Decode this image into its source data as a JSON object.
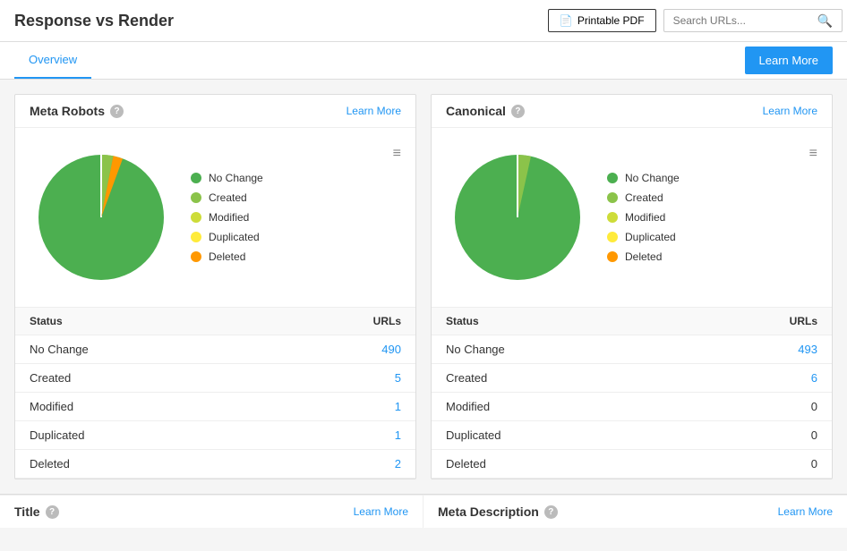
{
  "header": {
    "title": "Response vs Render",
    "printable_btn": "Printable PDF",
    "search_placeholder": "Search URLs...",
    "learn_more_btn": "Learn More"
  },
  "nav": {
    "tabs": [
      {
        "label": "Overview",
        "active": true
      }
    ],
    "learn_more": "Learn More"
  },
  "cards": [
    {
      "id": "meta-robots",
      "title": "Meta Robots",
      "learn_more": "Learn More",
      "legend": [
        {
          "label": "No Change",
          "color": "#4caf50"
        },
        {
          "label": "Created",
          "color": "#8bc34a"
        },
        {
          "label": "Modified",
          "color": "#cddc39"
        },
        {
          "label": "Duplicated",
          "color": "#ffeb3b"
        },
        {
          "label": "Deleted",
          "color": "#ff9800"
        }
      ],
      "pie": {
        "segments": [
          {
            "label": "No Change",
            "value": 490,
            "color": "#4caf50",
            "percentage": 97.4
          },
          {
            "label": "Created",
            "value": 5,
            "color": "#8bc34a",
            "percentage": 1.0
          },
          {
            "label": "Modified",
            "value": 1,
            "color": "#cddc39",
            "percentage": 0.2
          },
          {
            "label": "Duplicated",
            "value": 1,
            "color": "#ffeb3b",
            "percentage": 0.2
          },
          {
            "label": "Deleted",
            "value": 2,
            "color": "#ff9800",
            "percentage": 0.4
          }
        ]
      },
      "table": {
        "headers": [
          "Status",
          "URLs"
        ],
        "rows": [
          {
            "status": "No Change",
            "urls": "490",
            "is_link": true
          },
          {
            "status": "Created",
            "urls": "5",
            "is_link": true
          },
          {
            "status": "Modified",
            "urls": "1",
            "is_link": true
          },
          {
            "status": "Duplicated",
            "urls": "1",
            "is_link": true
          },
          {
            "status": "Deleted",
            "urls": "2",
            "is_link": true
          }
        ]
      }
    },
    {
      "id": "canonical",
      "title": "Canonical",
      "learn_more": "Learn More",
      "legend": [
        {
          "label": "No Change",
          "color": "#4caf50"
        },
        {
          "label": "Created",
          "color": "#8bc34a"
        },
        {
          "label": "Modified",
          "color": "#cddc39"
        },
        {
          "label": "Duplicated",
          "color": "#ffeb3b"
        },
        {
          "label": "Deleted",
          "color": "#ff9800"
        }
      ],
      "pie": {
        "segments": [
          {
            "label": "No Change",
            "value": 493,
            "color": "#4caf50",
            "percentage": 97.8
          },
          {
            "label": "Created",
            "value": 6,
            "color": "#8bc34a",
            "percentage": 1.2
          },
          {
            "label": "Modified",
            "value": 0,
            "color": "#cddc39",
            "percentage": 0
          },
          {
            "label": "Duplicated",
            "value": 0,
            "color": "#ffeb3b",
            "percentage": 0
          },
          {
            "label": "Deleted",
            "value": 0,
            "color": "#ff9800",
            "percentage": 0
          }
        ]
      },
      "table": {
        "headers": [
          "Status",
          "URLs"
        ],
        "rows": [
          {
            "status": "No Change",
            "urls": "493",
            "is_link": true
          },
          {
            "status": "Created",
            "urls": "6",
            "is_link": true
          },
          {
            "status": "Modified",
            "urls": "0",
            "is_link": false
          },
          {
            "status": "Duplicated",
            "urls": "0",
            "is_link": false
          },
          {
            "status": "Deleted",
            "urls": "0",
            "is_link": false
          }
        ]
      }
    }
  ],
  "bottom": [
    {
      "title": "Title",
      "learn_more": "Learn More"
    },
    {
      "title": "Meta Description",
      "learn_more": "Learn More"
    }
  ],
  "icons": {
    "file": "📄",
    "search": "🔍",
    "menu": "≡",
    "help": "?"
  }
}
